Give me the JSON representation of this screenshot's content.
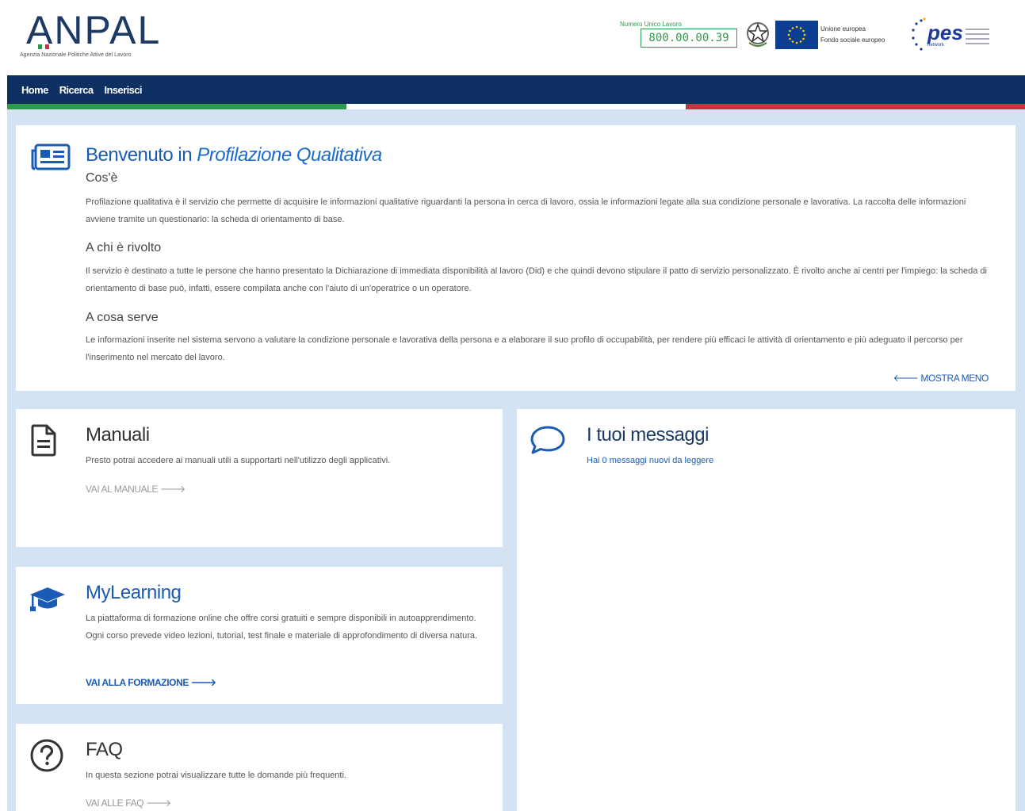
{
  "header": {
    "logo_text": "ANPAL",
    "logo_subtitle": "Agenzia Nazionale Politiche Attive del Lavoro",
    "numero_title": "Numero Unico Lavoro",
    "numero_value": "800.00.00.39",
    "eu_text": "Unione europea\nFondo sociale europeo",
    "pes_word": "pes",
    "pes_sub": "network",
    "colors": {
      "green": "#2e9a4a",
      "navy": "#0d2f61",
      "red": "#d12e3f",
      "eu_blue": "#0b3d91"
    }
  },
  "nav": {
    "items": [
      "Home",
      "Ricerca",
      "Inserisci"
    ]
  },
  "welcome": {
    "title_prefix": "Benvenuto in",
    "title_emph": "Profilazione Qualitativa",
    "cose_heading": "Cos'è",
    "cose_text": "Profilazione qualitativa è il servizio che permette di acquisire le informazioni qualitative riguardanti la persona in cerca di lavoro, ossia le informazioni legate alla sua condizione personale e lavorativa. La raccolta delle informazioni avviene tramite un questionario: la scheda di orientamento di base.",
    "rivolto_heading": "A chi è rivolto",
    "rivolto_text": "Il servizio è destinato a tutte le persone che hanno presentato la Dichiarazione di immediata disponibilità al lavoro (Did) e che quindi devono stipulare il patto di servizio personalizzato. È rivolto anche ai centri per l'impiego: la scheda di orientamento di base può, infatti, essere compilata anche con l'aiuto di un'operatrice o un operatore.",
    "serve_heading": "A cosa serve",
    "serve_text": "Le informazioni inserite nel sistema servono a valutare la condizione personale e lavorativa della persona e a elaborare il suo profilo di occupabilità, per rendere più efficaci le attività di orientamento e più adeguato il percorso per l'inserimento nel mercato del lavoro.",
    "mostra_meno": "🡐 MOSTRA MENO"
  },
  "manuali": {
    "title": "Manuali",
    "text": "Presto potrai accedere ai manuali utili a supportarti nell'utilizzo degli applicativi.",
    "link": "VAI AL MANUALE 🡒"
  },
  "messaggi": {
    "title": "I tuoi messaggi",
    "text": "Hai 0 messaggi nuovi da leggere"
  },
  "mylearning": {
    "title": "MyLearning",
    "text": "La piattaforma di formazione online che offre corsi gratuiti e sempre disponibili in autoapprendimento. Ogni corso prevede video lezioni, tutorial, test finale e materiale di approfondimento di diversa natura.",
    "link": "VAI ALLA FORMAZIONE 🡒"
  },
  "faq": {
    "title": "FAQ",
    "text": "In questa sezione potrai visualizzare tutte le domande più frequenti.",
    "link": "VAI ALLE FAQ 🡒"
  }
}
